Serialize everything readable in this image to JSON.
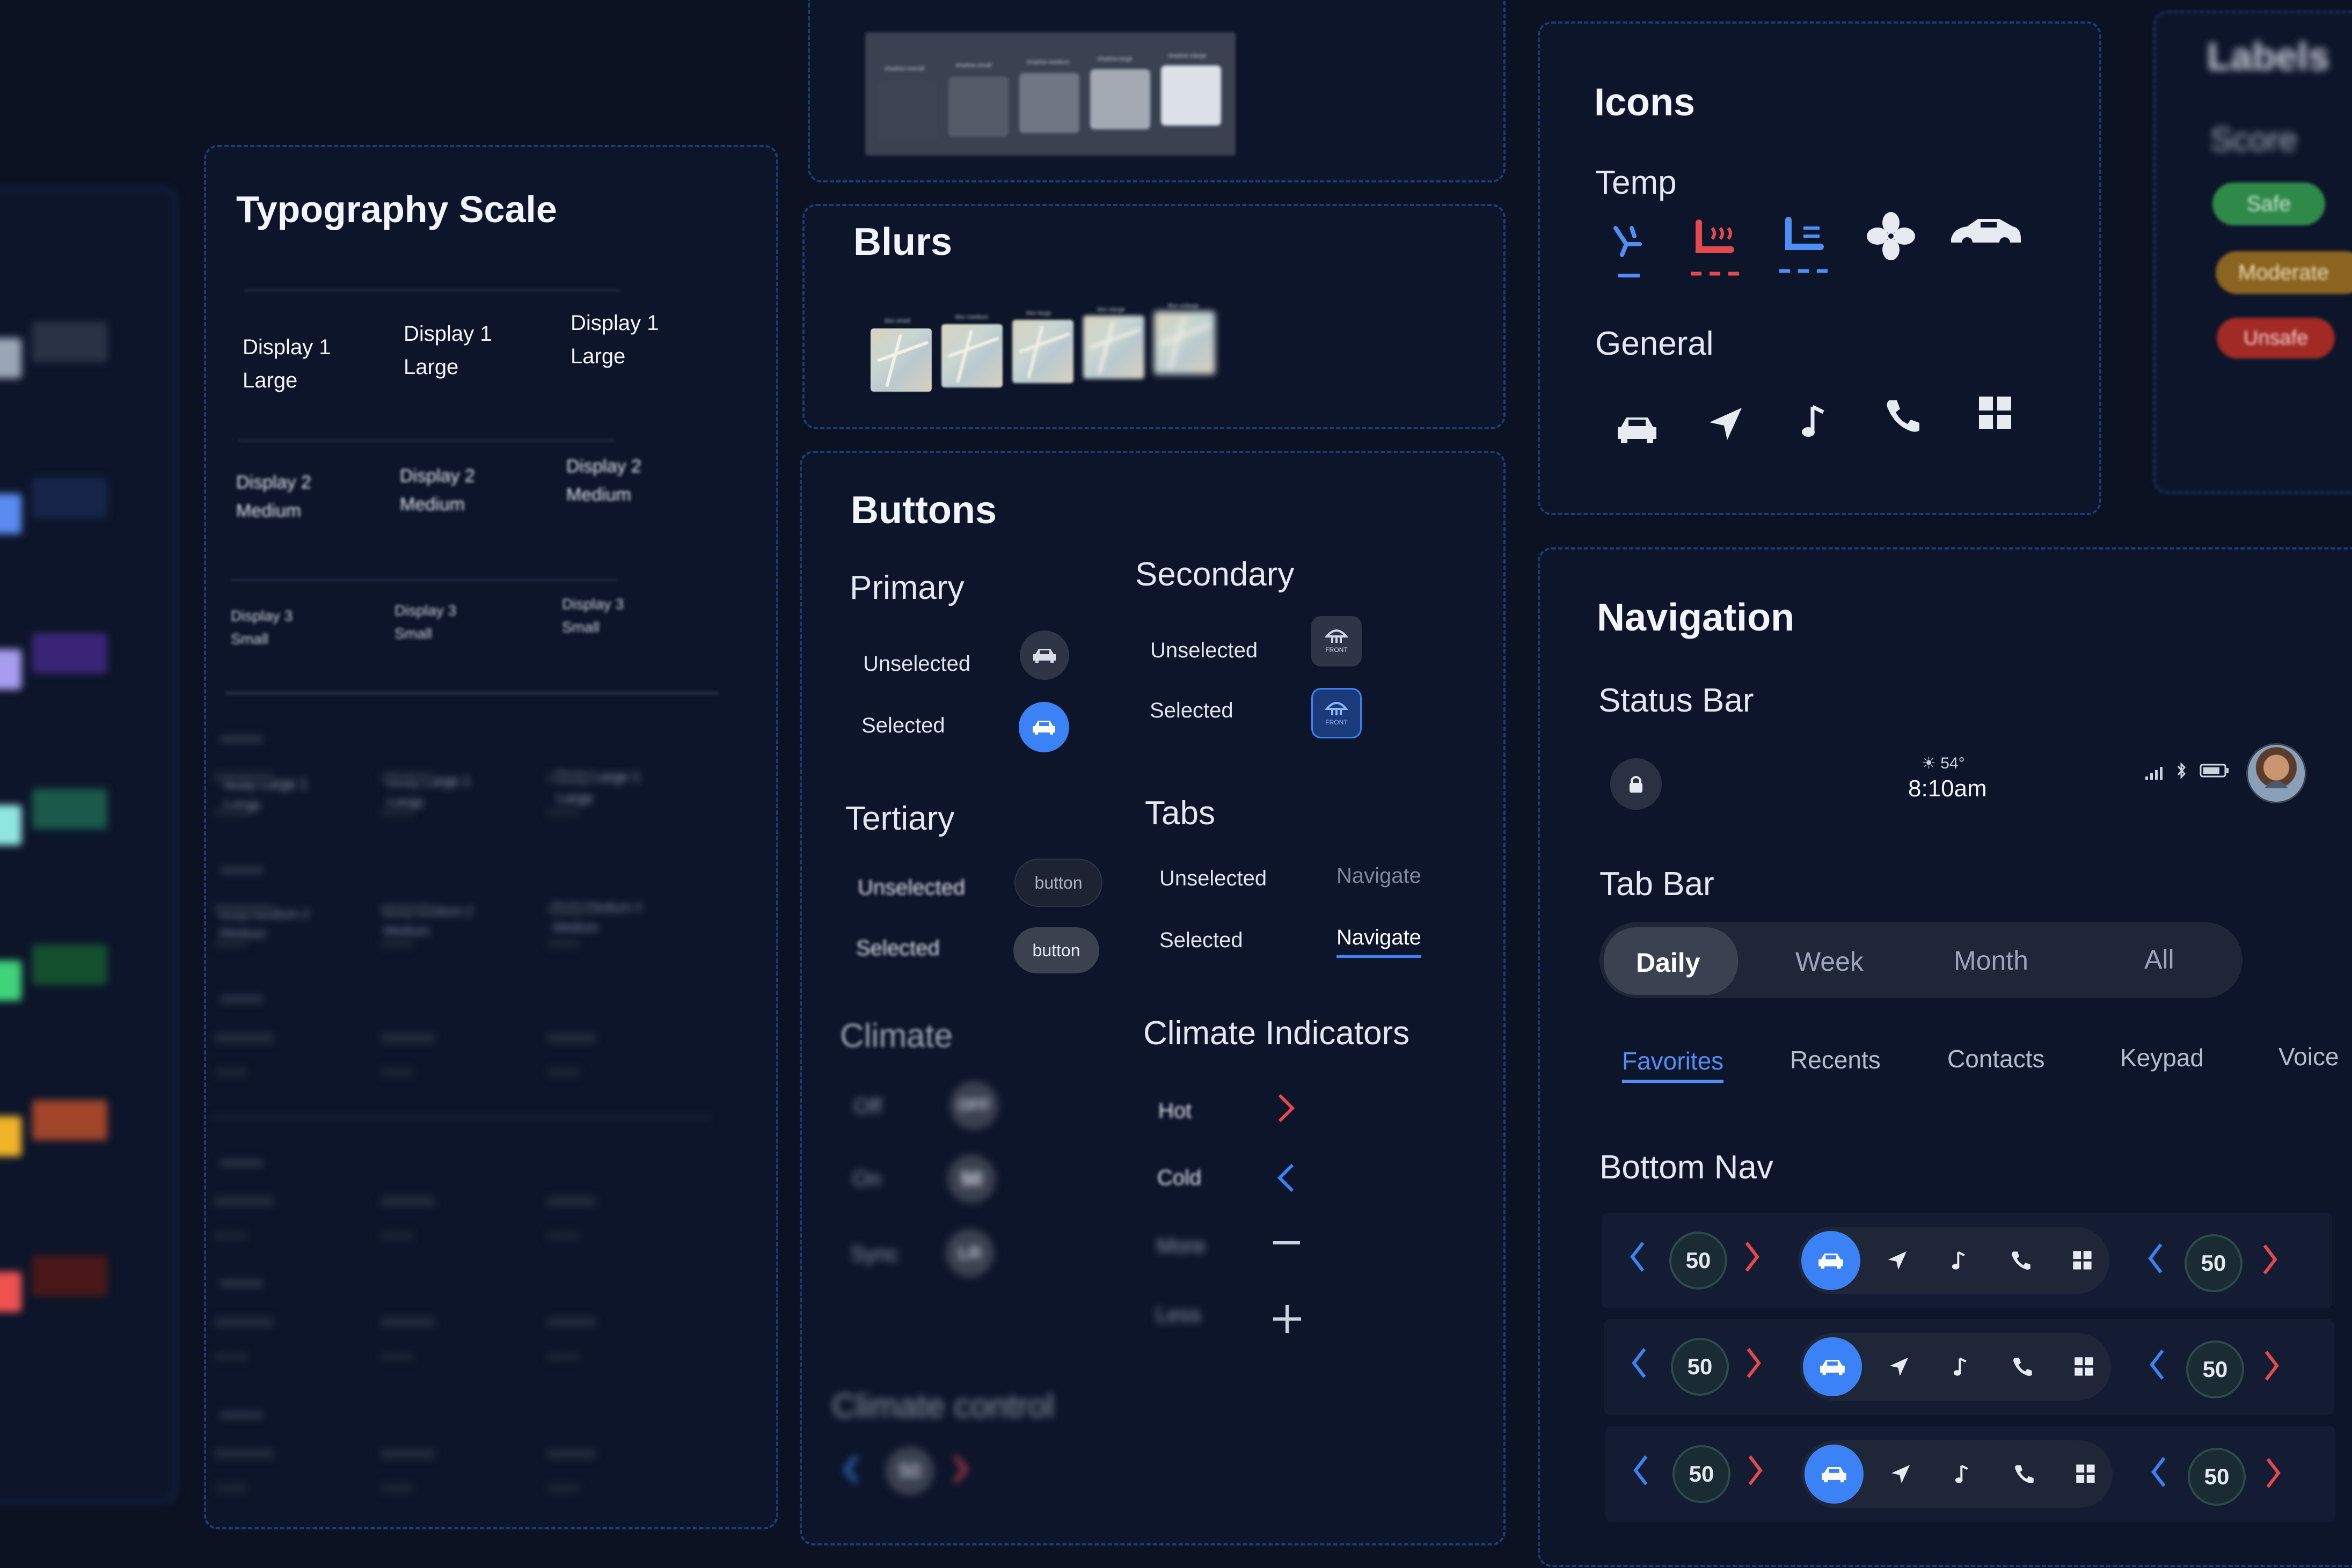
{
  "typography": {
    "title": "Typography Scale",
    "display_large": [
      {
        "l1": "Display 1",
        "l2": "Large"
      },
      {
        "l1": "Display 1",
        "l2": "Large"
      },
      {
        "l1": "Display 1",
        "l2": "Large"
      }
    ],
    "display_medium": [
      {
        "l1": "Display 2",
        "l2": "Medium"
      },
      {
        "l1": "Display 2",
        "l2": "Medium"
      },
      {
        "l1": "Display 2",
        "l2": "Medium"
      }
    ],
    "display_small": [
      {
        "l1": "Display 3",
        "l2": "Small"
      },
      {
        "l1": "Display 3",
        "l2": "Small"
      },
      {
        "l1": "Display 3",
        "l2": "Small"
      }
    ],
    "body_large": [
      {
        "l1": "Body Large 1",
        "l2": "Large"
      },
      {
        "l1": "Body Large 1",
        "l2": "Large"
      },
      {
        "l1": "Body Large 1",
        "l2": "Large"
      }
    ],
    "body_medium": [
      {
        "l1": "Body Medium 2",
        "l2": "Medium"
      },
      {
        "l1": "Body Medium 2",
        "l2": "Medium"
      },
      {
        "l1": "Body Medium 2",
        "l2": "Medium"
      }
    ]
  },
  "blurs": {
    "title": "Blurs",
    "swatches": [
      "blur-small",
      "blur-medium",
      "blur-large",
      "blur-xlarge",
      "blur-xxlarge"
    ]
  },
  "shadows": {
    "swatches": [
      "shadow-overall",
      "shadow-small",
      "shadow-medium",
      "shadow-large",
      "shadow-xlarge"
    ]
  },
  "buttons": {
    "title": "Buttons",
    "primary": {
      "title": "Primary",
      "unselected": "Unselected",
      "selected": "Selected"
    },
    "secondary": {
      "title": "Secondary",
      "unselected": "Unselected",
      "selected": "Selected",
      "icon_label": "FRONT"
    },
    "tertiary": {
      "title": "Tertiary",
      "unselected": "Unselected",
      "selected": "Selected",
      "button_label": "button"
    },
    "tabs": {
      "title": "Tabs",
      "unselected": "Unselected",
      "selected": "Selected",
      "tab_label": "Navigate"
    },
    "climate": {
      "title": "Climate",
      "off": "Off",
      "on": "On",
      "sync": "Sync",
      "off_value": "OFF",
      "on_value": "50",
      "sync_value": "LR"
    },
    "climate_indicators": {
      "title": "Climate Indicators",
      "hot": "Hot",
      "cold": "Cold",
      "more": "More",
      "less": "Less"
    },
    "climate_control": {
      "title": "Climate control",
      "value": "50"
    }
  },
  "icons": {
    "title": "Icons",
    "temp": {
      "title": "Temp",
      "items": [
        "seat-recline-icon",
        "seat-heat-icon",
        "seat-cool-icon",
        "fan-icon",
        "car-defrost-icon"
      ]
    },
    "general": {
      "title": "General",
      "items": [
        "car-icon",
        "navigation-arrow-icon",
        "music-note-icon",
        "phone-icon",
        "grid-icon"
      ]
    }
  },
  "labels": {
    "title": "Labels",
    "score": "Score",
    "badges": [
      {
        "text": "Safe",
        "color": "#2f8a4a"
      },
      {
        "text": "Moderate",
        "color": "#8a6420"
      },
      {
        "text": "Unsafe",
        "color": "#a22a25"
      }
    ]
  },
  "navigation": {
    "title": "Navigation",
    "status_bar": {
      "title": "Status Bar",
      "weather": "☀ 54°",
      "time": "8:10am"
    },
    "tab_bar": {
      "title": "Tab Bar",
      "tabs": [
        "Daily",
        "Week",
        "Month",
        "All"
      ],
      "selected": "Daily"
    },
    "phone_tabs": {
      "tabs": [
        "Favorites",
        "Recents",
        "Contacts",
        "Keypad",
        "Voice"
      ],
      "selected": "Favorites"
    },
    "bottom_nav": {
      "title": "Bottom Nav",
      "rows": [
        {
          "left_temp": "50",
          "right_temp": "50"
        },
        {
          "left_temp": "50",
          "right_temp": "50"
        },
        {
          "left_temp": "50",
          "right_temp": "50"
        }
      ]
    }
  },
  "colors": {
    "accent_blue": "#3b82f6",
    "hot_red": "#e5484d",
    "page_bg": "#0b1222",
    "panel_bg": "#0d152a",
    "panel_border": "#1e3a78"
  },
  "palette_swatches": [
    "#9aa6b6",
    "#2a3346",
    "#5a8cf0",
    "#16254a",
    "#a99cf0",
    "#3a2676",
    "#8fe6e0",
    "#1b5a4a",
    "#3fd37a",
    "#14502e",
    "#f0b42a",
    "#a0452a",
    "#f05252",
    "#4a1818"
  ]
}
